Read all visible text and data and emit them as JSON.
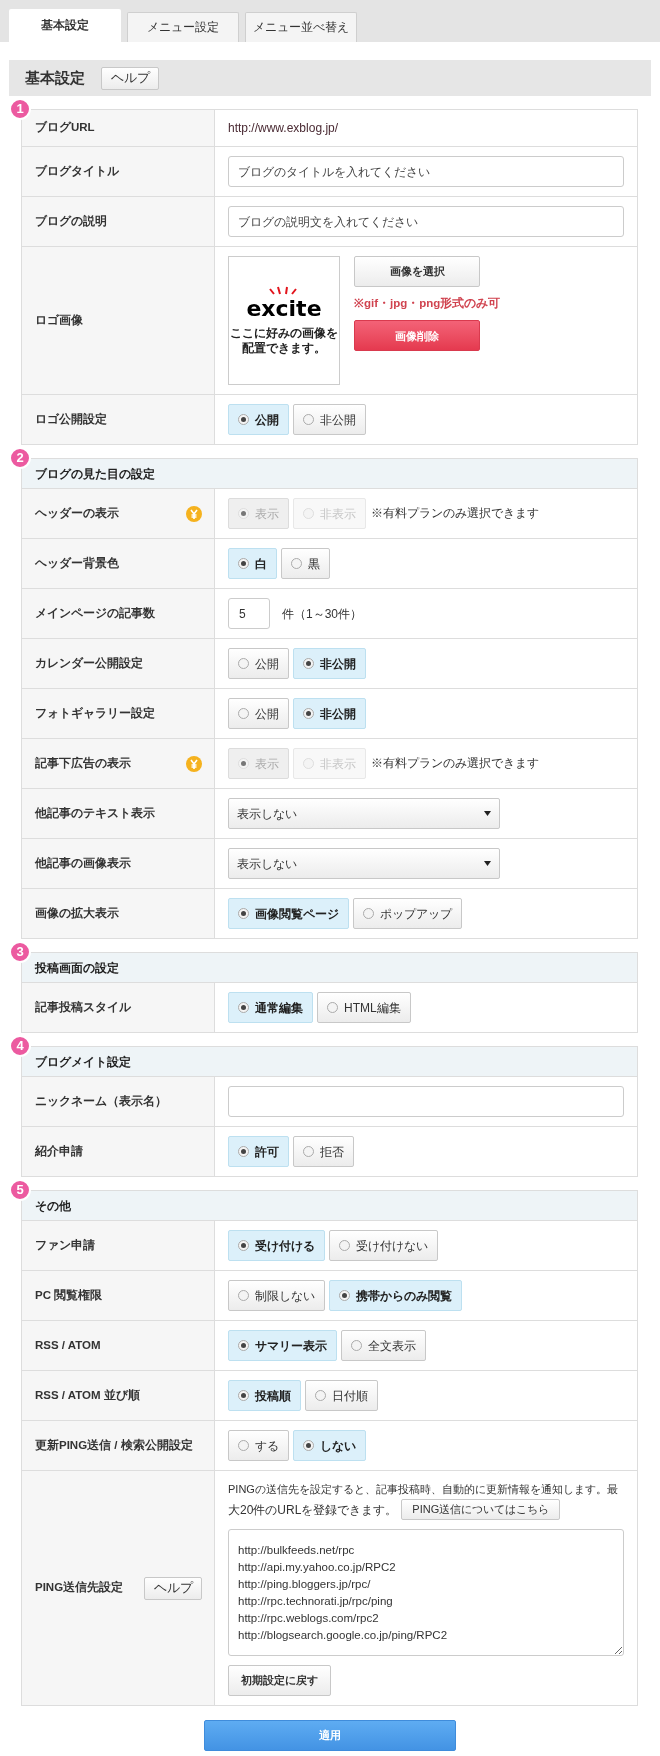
{
  "tabs": [
    {
      "label": "基本設定",
      "selected": true
    },
    {
      "label": "メニュー設定",
      "selected": false
    },
    {
      "label": "メニュー並べ替え",
      "selected": false
    }
  ],
  "heading": {
    "title": "基本設定",
    "help": "ヘルプ"
  },
  "sections": [
    {
      "number": "1",
      "rows": [
        {
          "label": "ブログURL",
          "kind": "text",
          "value": "http://www.exblog.jp/"
        },
        {
          "label": "ブログタイトル",
          "kind": "input",
          "placeholder": "ブログのタイトルを入れてください"
        },
        {
          "label": "ブログの説明",
          "kind": "input",
          "placeholder": "ブログの説明文を入れてください"
        },
        {
          "label": "ロゴ画像",
          "kind": "logo",
          "logo_text": "excite",
          "caption": [
            "ここに好みの画像を",
            "配置できます。"
          ],
          "select_button": "画像を選択",
          "note": "※gif・jpg・png形式のみ可",
          "delete_button": "画像削除"
        },
        {
          "label": "ロゴ公開設定",
          "kind": "radio",
          "options": [
            {
              "label": "公開",
              "selected": true
            },
            {
              "label": "非公開",
              "selected": false
            }
          ]
        }
      ]
    },
    {
      "number": "2",
      "title": "ブログの見た目の設定",
      "rows": [
        {
          "label": "ヘッダーの表示",
          "kind": "radio",
          "premium": true,
          "disabled": true,
          "note": "※有料プランのみ選択できます",
          "options": [
            {
              "label": "表示",
              "selected": true
            },
            {
              "label": "非表示",
              "selected": false
            }
          ]
        },
        {
          "label": "ヘッダー背景色",
          "kind": "radio",
          "options": [
            {
              "label": "白",
              "selected": true
            },
            {
              "label": "黒",
              "selected": false
            }
          ]
        },
        {
          "label": "メインページの記事数",
          "kind": "number",
          "value": "5",
          "unit": "件（1～30件）"
        },
        {
          "label": "カレンダー公開設定",
          "kind": "radio",
          "options": [
            {
              "label": "公開",
              "selected": false
            },
            {
              "label": "非公開",
              "selected": true
            }
          ]
        },
        {
          "label": "フォトギャラリー設定",
          "kind": "radio",
          "options": [
            {
              "label": "公開",
              "selected": false
            },
            {
              "label": "非公開",
              "selected": true
            }
          ]
        },
        {
          "label": "記事下広告の表示",
          "kind": "radio",
          "premium": true,
          "disabled": true,
          "note": "※有料プランのみ選択できます",
          "options": [
            {
              "label": "表示",
              "selected": true
            },
            {
              "label": "非表示",
              "selected": false
            }
          ]
        },
        {
          "label": "他記事のテキスト表示",
          "kind": "select",
          "value": "表示しない"
        },
        {
          "label": "他記事の画像表示",
          "kind": "select",
          "value": "表示しない"
        },
        {
          "label": "画像の拡大表示",
          "kind": "radio",
          "options": [
            {
              "label": "画像閲覧ページ",
              "selected": true
            },
            {
              "label": "ポップアップ",
              "selected": false
            }
          ]
        }
      ]
    },
    {
      "number": "3",
      "title": "投稿画面の設定",
      "rows": [
        {
          "label": "記事投稿スタイル",
          "kind": "radio",
          "options": [
            {
              "label": "通常編集",
              "selected": true
            },
            {
              "label": "HTML編集",
              "selected": false
            }
          ]
        }
      ]
    },
    {
      "number": "4",
      "title": "ブログメイト設定",
      "rows": [
        {
          "label": "ニックネーム（表示名）",
          "kind": "input"
        },
        {
          "label": "紹介申請",
          "kind": "radio",
          "options": [
            {
              "label": "許可",
              "selected": true
            },
            {
              "label": "拒否",
              "selected": false
            }
          ]
        }
      ]
    },
    {
      "number": "5",
      "title": "その他",
      "rows": [
        {
          "label": "ファン申請",
          "kind": "radio",
          "options": [
            {
              "label": "受け付ける",
              "selected": true
            },
            {
              "label": "受け付けない",
              "selected": false
            }
          ]
        },
        {
          "label": "PC 閲覧権限",
          "kind": "radio",
          "options": [
            {
              "label": "制限しない",
              "selected": false
            },
            {
              "label": "携帯からのみ閲覧",
              "selected": true
            }
          ]
        },
        {
          "label": "RSS / ATOM",
          "kind": "radio",
          "options": [
            {
              "label": "サマリー表示",
              "selected": true
            },
            {
              "label": "全文表示",
              "selected": false
            }
          ]
        },
        {
          "label": "RSS / ATOM 並び順",
          "kind": "radio",
          "options": [
            {
              "label": "投稿順",
              "selected": true
            },
            {
              "label": "日付順",
              "selected": false
            }
          ]
        },
        {
          "label": "更新PING送信 / 検索公開設定",
          "kind": "radio",
          "options": [
            {
              "label": "する",
              "selected": false
            },
            {
              "label": "しない",
              "selected": true
            }
          ]
        },
        {
          "label": "PING送信先設定",
          "kind": "ping",
          "help": "ヘルプ",
          "description": [
            "PINGの送信先を設定すると、記事投稿時、自動的に更新情報を通知します。最",
            "大20件のURLを登録できます。"
          ],
          "link_button": "PING送信についてはこちら",
          "urls": [
            "http://bulkfeeds.net/rpc",
            "http://api.my.yahoo.co.jp/RPC2",
            "http://ping.bloggers.jp/rpc/",
            "http://rpc.technorati.jp/rpc/ping",
            "http://rpc.weblogs.com/rpc2",
            "http://blogsearch.google.co.jp/ping/RPC2"
          ],
          "reset_button": "初期設定に戻す"
        }
      ]
    }
  ],
  "apply_button": "適用"
}
